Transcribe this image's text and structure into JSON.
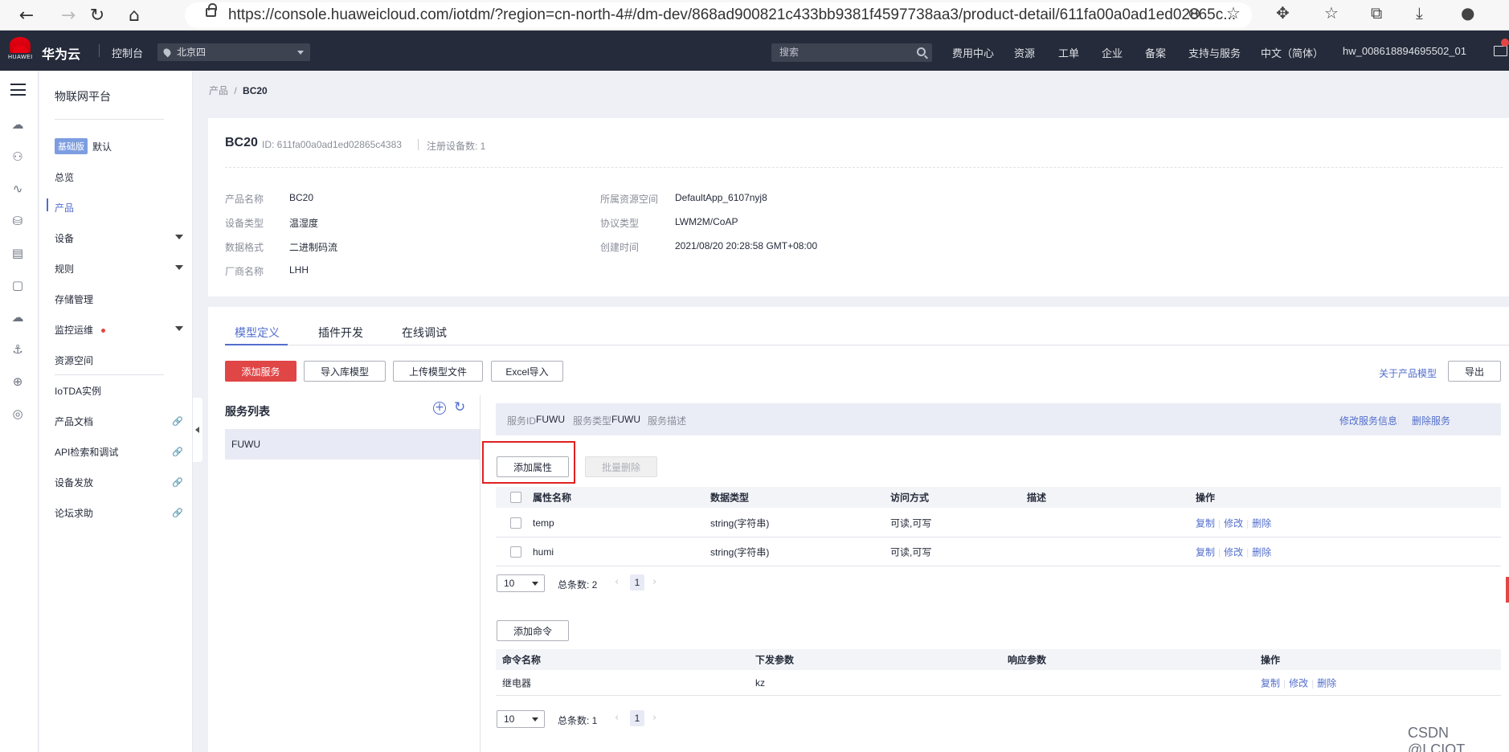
{
  "browser": {
    "url": "https://console.huaweicloud.com/iotdm/?region=cn-north-4#/dm-dev/868ad900821c433bb9381f4597738aa3/product-detail/611fa00a0ad1ed02865c..."
  },
  "topnav": {
    "logo_text": "HUAWEI",
    "brand": "华为云",
    "console": "控制台",
    "region": "北京四",
    "search_placeholder": "搜索",
    "menu": [
      "费用中心",
      "资源",
      "工单",
      "企业",
      "备案",
      "支持与服务",
      "中文（简体）",
      "hw_008618894695502_01"
    ]
  },
  "sidebar": {
    "title": "物联网平台",
    "edition_tag": "基础版",
    "edition_label": "默认",
    "items": [
      "总览",
      "产品",
      "设备",
      "规则",
      "存储管理",
      "监控运维",
      "资源空间",
      "IoTDA实例",
      "产品文档",
      "API检索和调试",
      "设备发放",
      "论坛求助"
    ]
  },
  "breadcrumb": {
    "parent": "产品",
    "sep": "/",
    "current": "BC20"
  },
  "product": {
    "name": "BC20",
    "id_text": "ID: 611fa00a0ad1ed02865c4383",
    "registered_text": "注册设备数: 1",
    "fields_left": [
      {
        "label": "产品名称",
        "value": "BC20"
      },
      {
        "label": "设备类型",
        "value": "温湿度"
      },
      {
        "label": "数据格式",
        "value": "二进制码流"
      },
      {
        "label": "厂商名称",
        "value": "LHH"
      }
    ],
    "fields_right": [
      {
        "label": "所属资源空间",
        "value": "DefaultApp_6107nyj8"
      },
      {
        "label": "协议类型",
        "value": "LWM2M/CoAP"
      },
      {
        "label": "创建时间",
        "value": "2021/08/20 20:28:58 GMT+08:00"
      }
    ]
  },
  "tabs": [
    "模型定义",
    "插件开发",
    "在线调试"
  ],
  "toolbar": {
    "add_service": "添加服务",
    "import_model": "导入库模型",
    "upload_model": "上传模型文件",
    "excel_import": "Excel导入",
    "about_model": "关于产品模型",
    "export": "导出"
  },
  "service_list": {
    "title": "服务列表",
    "items": [
      "FUWU"
    ]
  },
  "service": {
    "id_label": "服务ID",
    "id_value": "FUWU",
    "type_label": "服务类型",
    "type_value": "FUWU",
    "desc_label": "服务描述",
    "edit_link": "修改服务信息",
    "delete_link": "删除服务"
  },
  "properties": {
    "add_button": "添加属性",
    "batch_delete": "批量删除",
    "columns": [
      "属性名称",
      "数据类型",
      "访问方式",
      "描述",
      "操作"
    ],
    "rows": [
      {
        "name": "temp",
        "type": "string(字符串)",
        "access": "可读,可写",
        "desc": ""
      },
      {
        "name": "humi",
        "type": "string(字符串)",
        "access": "可读,可写",
        "desc": ""
      }
    ],
    "page_size": "10",
    "total": "总条数: 2",
    "page": "1"
  },
  "commands": {
    "add_button": "添加命令",
    "columns": [
      "命令名称",
      "下发参数",
      "响应参数",
      "操作"
    ],
    "rows": [
      {
        "name": "继电器",
        "params": "kz",
        "response": ""
      }
    ],
    "page_size": "10",
    "total": "总条数: 1",
    "page": "1"
  },
  "actions": {
    "copy": "复制",
    "edit": "修改",
    "delete": "删除"
  },
  "watermark": "CSDN @LCIOT"
}
